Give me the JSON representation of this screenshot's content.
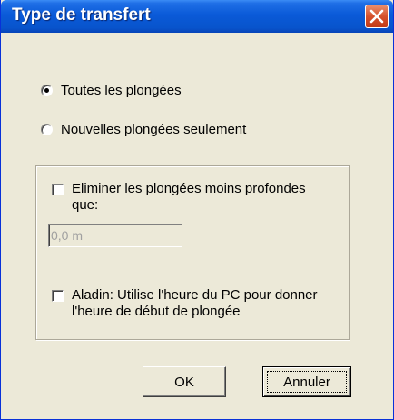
{
  "window": {
    "title": "Type de transfert"
  },
  "options": {
    "all_dives": "Toutes les plongées",
    "new_dives_only": "Nouvelles plongées seulement",
    "selected": "all_dives"
  },
  "filters": {
    "eliminate_label": "Eliminer les plongées moins profondes que:",
    "eliminate_checked": false,
    "depth_value": "0,0 m",
    "aladin_label": "Aladin: Utilise l'heure du PC pour donner l'heure de début de plongée",
    "aladin_checked": false
  },
  "buttons": {
    "ok": "OK",
    "cancel": "Annuler"
  },
  "colors": {
    "titlebar": "#0a5ad8",
    "close_button": "#d6512c",
    "dialog_background": "#ece9d8"
  },
  "icons": {
    "close": "close-icon"
  }
}
